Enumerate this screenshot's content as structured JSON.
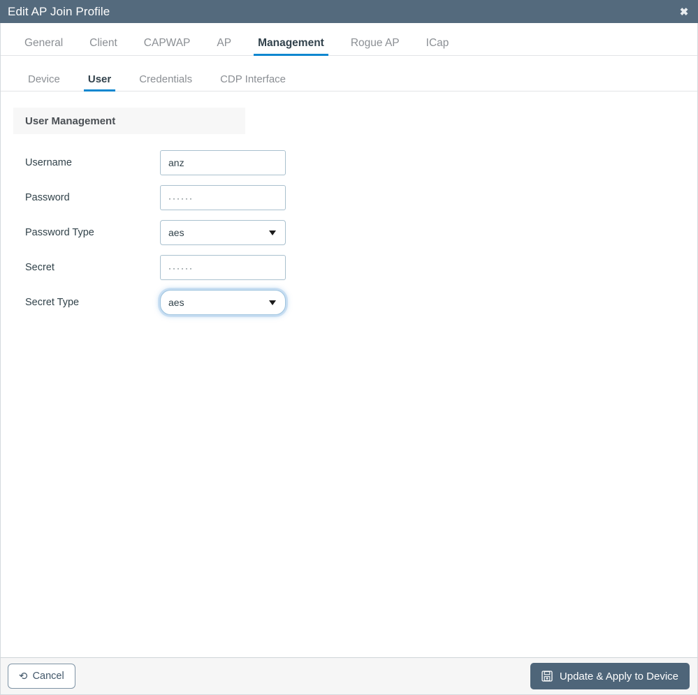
{
  "titlebar": {
    "title": "Edit AP Join Profile",
    "close_label": "✖"
  },
  "tabs_primary": [
    {
      "label": "General",
      "active": false
    },
    {
      "label": "Client",
      "active": false
    },
    {
      "label": "CAPWAP",
      "active": false
    },
    {
      "label": "AP",
      "active": false
    },
    {
      "label": "Management",
      "active": true
    },
    {
      "label": "Rogue AP",
      "active": false
    },
    {
      "label": "ICap",
      "active": false
    }
  ],
  "tabs_secondary": [
    {
      "label": "Device",
      "active": false
    },
    {
      "label": "User",
      "active": true
    },
    {
      "label": "Credentials",
      "active": false
    },
    {
      "label": "CDP Interface",
      "active": false
    }
  ],
  "section": {
    "title": "User Management"
  },
  "form": {
    "username": {
      "label": "Username",
      "value": "anz",
      "placeholder": ""
    },
    "password": {
      "label": "Password",
      "value": "······",
      "placeholder": ""
    },
    "password_type": {
      "label": "Password Type",
      "value": "aes"
    },
    "secret": {
      "label": "Secret",
      "value": "······",
      "placeholder": ""
    },
    "secret_type": {
      "label": "Secret Type",
      "value": "aes"
    }
  },
  "footer": {
    "cancel_label": "Cancel",
    "cancel_icon": "revert-icon",
    "submit_label": "Update & Apply to Device",
    "submit_icon": "save-icon"
  },
  "colors": {
    "titlebar_bg": "#546a7d",
    "accent_blue": "#0f87d0",
    "primary_button_bg": "#4e6579",
    "input_border": "#a9c0ce",
    "section_band_bg": "#f7f7f7"
  }
}
